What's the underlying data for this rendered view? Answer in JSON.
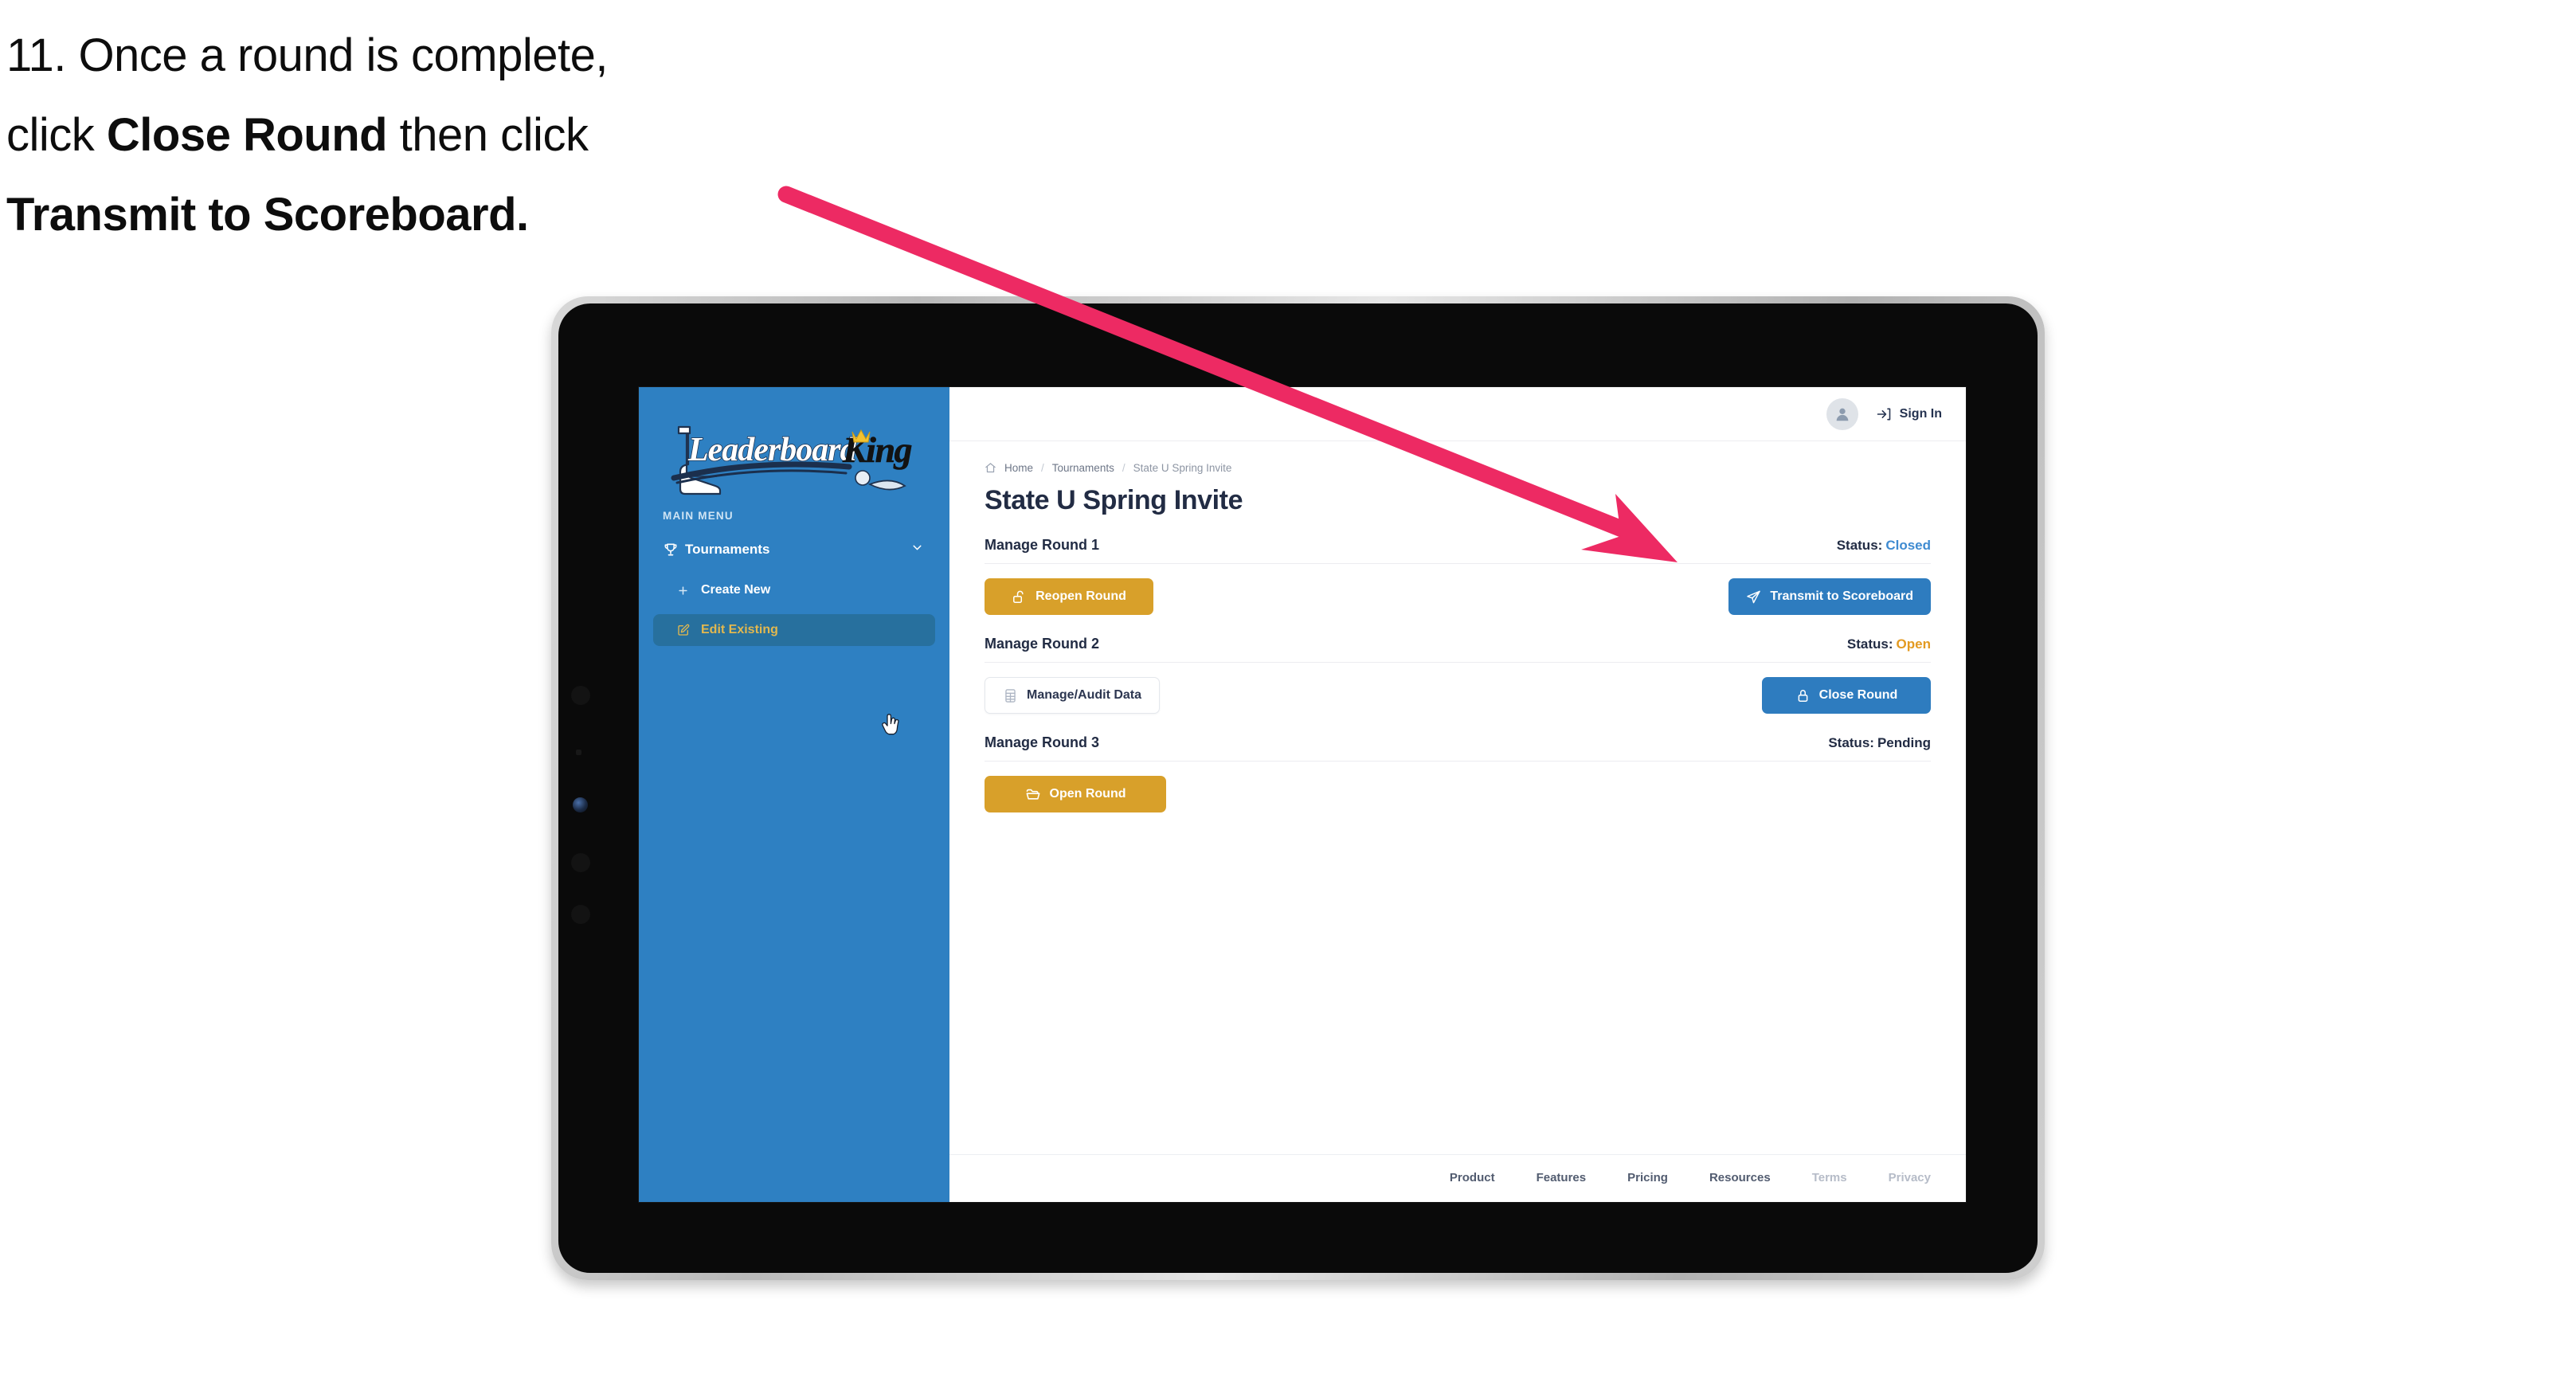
{
  "caption": {
    "line1_plain": "11. Once a round is complete,",
    "line2_pre": "click ",
    "line2_bold": "Close Round",
    "line2_post": " then click",
    "line3_bold": "Transmit to Scoreboard."
  },
  "colors": {
    "accent_blue": "#2E7CBF",
    "sidebar_blue": "#2E80C2",
    "gold": "#D8A02A",
    "status_open": "#E39A21",
    "status_closed": "#3F8BD1",
    "arrow_pink": "#ED2A63",
    "text_dark": "#222c44"
  },
  "sidebar": {
    "logo_text_primary": "Leaderboard",
    "logo_text_secondary": "King",
    "menu_label": "MAIN MENU",
    "items": [
      {
        "label": "Tournaments",
        "icon": "trophy-icon",
        "expand_icon": "chevron-down-icon",
        "active": false
      },
      {
        "label": "Create New",
        "icon": "plus-icon",
        "active": false
      },
      {
        "label": "Edit Existing",
        "icon": "edit-pencil-icon",
        "active": true
      }
    ]
  },
  "topbar": {
    "avatar_icon": "user-avatar-icon",
    "signin_icon": "sign-in-arrow-icon",
    "signin_label": "Sign In"
  },
  "breadcrumb": {
    "home_icon": "home-icon",
    "items": [
      "Home",
      "Tournaments",
      "State U Spring Invite"
    ],
    "separator": "/"
  },
  "page": {
    "title": "State U Spring Invite"
  },
  "rounds": [
    {
      "title": "Manage Round 1",
      "status_label": "Status:",
      "status_value": "Closed",
      "status_kind": "closed",
      "left_button": {
        "label": "Reopen Round",
        "icon": "unlock-icon",
        "style": "gold"
      },
      "right_button": {
        "label": "Transmit to Scoreboard",
        "icon": "paper-plane-icon",
        "style": "blue"
      }
    },
    {
      "title": "Manage Round 2",
      "status_label": "Status:",
      "status_value": "Open",
      "status_kind": "open",
      "left_button": {
        "label": "Manage/Audit Data",
        "icon": "grid-table-icon",
        "style": "ghost"
      },
      "right_button": {
        "label": "Close Round",
        "icon": "lock-icon",
        "style": "blue"
      }
    },
    {
      "title": "Manage Round 3",
      "status_label": "Status:",
      "status_value": "Pending",
      "status_kind": "pending",
      "left_button": {
        "label": "Open Round",
        "icon": "folder-open-icon",
        "style": "gold"
      },
      "right_button": null
    }
  ],
  "footer": {
    "links": [
      {
        "label": "Product",
        "muted": false
      },
      {
        "label": "Features",
        "muted": false
      },
      {
        "label": "Pricing",
        "muted": false
      },
      {
        "label": "Resources",
        "muted": false
      },
      {
        "label": "Terms",
        "muted": true
      },
      {
        "label": "Privacy",
        "muted": true
      }
    ]
  },
  "annotation": {
    "arrow_name": "pink-pointer-arrow",
    "points_to": "Transmit to Scoreboard"
  }
}
